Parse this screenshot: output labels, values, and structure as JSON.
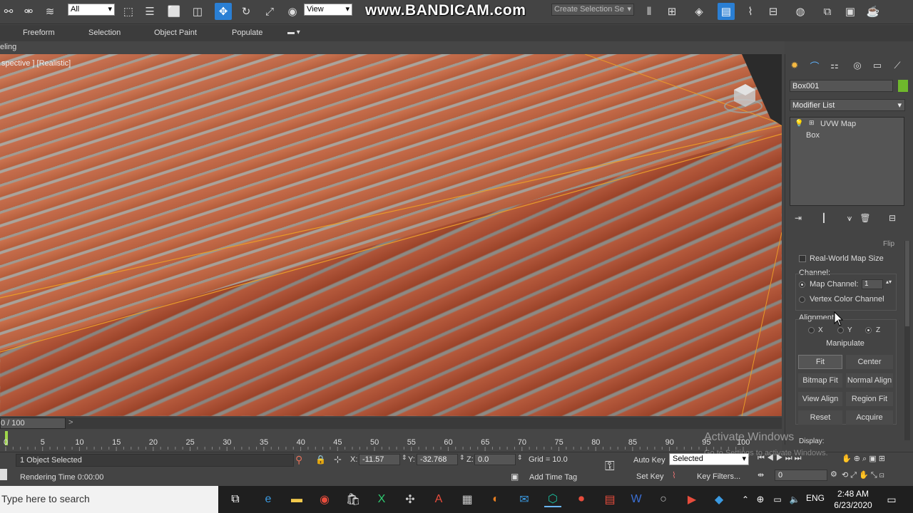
{
  "toolbar": {
    "selection_filter": "All",
    "reference_coord": "View",
    "named_selection_placeholder": "Create Selection Se",
    "watermark": "www.BANDICAM.com"
  },
  "ribbon": {
    "tabs": [
      "Freeform",
      "Selection",
      "Object Paint",
      "Populate"
    ],
    "subtab": "eling"
  },
  "viewport": {
    "label": "spective ] [Realistic]"
  },
  "command_panel": {
    "object_name": "Box001",
    "object_color": "#6fb82c",
    "modifier_list": "Modifier List",
    "stack": [
      "UVW Map",
      "Box"
    ],
    "partial_label": "Flip",
    "real_world_map_size": "Real-World Map Size",
    "channel_label": "Channel:",
    "map_channel_label": "Map Channel:",
    "map_channel_value": "1",
    "vertex_color_channel": "Vertex Color Channel",
    "alignment_label": "Alignment:",
    "axes": [
      "X",
      "Y",
      "Z"
    ],
    "selected_axis": "Z",
    "manipulate": "Manipulate",
    "buttons": [
      "Fit",
      "Center",
      "Bitmap Fit",
      "Normal Align",
      "View Align",
      "Region Fit",
      "Reset",
      "Acquire"
    ],
    "display_label": "Display:"
  },
  "timeline": {
    "frame_counter": "0 / 100",
    "ticks": [
      "0",
      "5",
      "10",
      "15",
      "20",
      "25",
      "30",
      "35",
      "40",
      "45",
      "50",
      "55",
      "60",
      "65",
      "70",
      "75",
      "80",
      "85",
      "90",
      "95",
      "100"
    ]
  },
  "status": {
    "selection": "1 Object Selected",
    "rendering_time": "Rendering Time  0:00:00",
    "x_label": "X:",
    "x": "-11.57",
    "y_label": "Y:",
    "y": "-32.768",
    "z_label": "Z:",
    "z": "0.0",
    "grid": "Grid = 10.0",
    "add_time_tag": "Add Time Tag",
    "auto_key": "Auto Key",
    "selected": "Selected",
    "set_key": "Set Key",
    "key_filters": "Key Filters...",
    "current_frame": "0"
  },
  "activate_windows": {
    "title": "Activate Windows",
    "subtitle": "Go to Settings to activate Windows."
  },
  "taskbar": {
    "search_placeholder": "Type here to search",
    "language": "ENG",
    "time": "2:48 AM",
    "date": "6/23/2020"
  }
}
